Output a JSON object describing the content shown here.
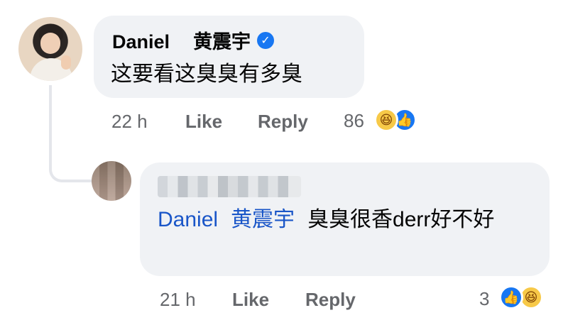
{
  "comment": {
    "author_first": "Daniel",
    "author_second": "黄震宇",
    "text": "这要看这臭臭有多臭",
    "time": "22 h",
    "like": "Like",
    "reply": "Reply",
    "reaction_count": "86",
    "reactions": [
      "haha-icon",
      "like-icon"
    ]
  },
  "reply": {
    "mention_first": "Daniel",
    "mention_second": "黄震宇",
    "text": "臭臭很香derr好不好",
    "time": "21 h",
    "like": "Like",
    "reply": "Reply",
    "reaction_count": "3",
    "reactions": [
      "like-icon",
      "haha-icon"
    ]
  },
  "colors": {
    "bubble": "#f0f2f5",
    "meta": "#65676b",
    "mention": "#1a56c8",
    "verified": "#1877f2"
  }
}
